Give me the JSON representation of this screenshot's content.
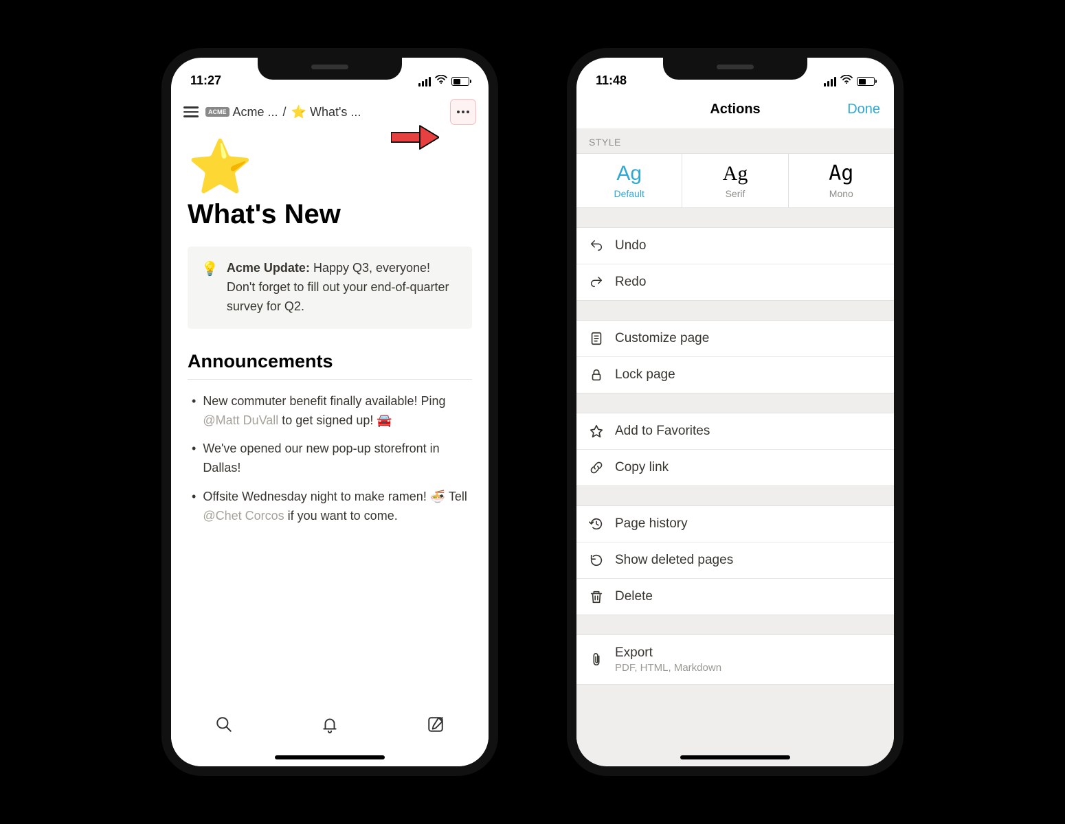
{
  "phone1": {
    "time": "11:27",
    "breadcrumb": {
      "seg1": "Acme ...",
      "seg2": "What's ..."
    },
    "page": {
      "icon": "⭐",
      "title": "What's New"
    },
    "callout": {
      "icon": "💡",
      "bold": "Acme Update:",
      "text": " Happy Q3, everyone! Don't forget to fill out your end-of-quarter survey for Q2."
    },
    "section": "Announcements",
    "announcements": [
      {
        "pre": "New commuter benefit finally available! Ping ",
        "mention": "@Matt DuVall",
        "post": " to get signed up! 🚘"
      },
      {
        "pre": "We've opened our new pop-up storefront in Dallas!",
        "mention": "",
        "post": ""
      },
      {
        "pre": "Offsite Wednesday night to make ramen! 🍜 Tell ",
        "mention": "@Chet Corcos",
        "post": " if you want to come."
      }
    ]
  },
  "phone2": {
    "time": "11:48",
    "header": {
      "title": "Actions",
      "done": "Done"
    },
    "styleLabel": "STYLE",
    "styles": {
      "default": {
        "sample": "Ag",
        "label": "Default"
      },
      "serif": {
        "sample": "Ag",
        "label": "Serif"
      },
      "mono": {
        "sample": "Ag",
        "label": "Mono"
      }
    },
    "group1": {
      "undo": "Undo",
      "redo": "Redo"
    },
    "group2": {
      "customize": "Customize page",
      "lock": "Lock page"
    },
    "group3": {
      "fav": "Add to Favorites",
      "copy": "Copy link"
    },
    "group4": {
      "history": "Page history",
      "deleted": "Show deleted pages",
      "delete": "Delete"
    },
    "group5": {
      "export": "Export",
      "exportSub": "PDF, HTML, Markdown"
    }
  }
}
